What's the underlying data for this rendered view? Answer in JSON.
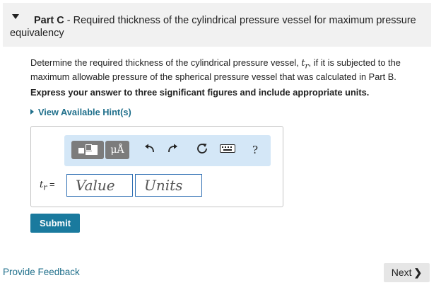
{
  "part": {
    "label": "Part C",
    "separator": " - ",
    "title": "Required thickness of the cylindrical pressure vessel for maximum pressure equivalency"
  },
  "question": {
    "before_symbol": "Determine the required thickness of the cylindrical pressure vessel, ",
    "symbol": "t",
    "symbol_subscript": "r",
    "after_symbol": ", if it is subjected to the maximum allowable pressure of the spherical pressure vessel that was calculated in Part B."
  },
  "instruction": "Express your answer to three significant figures and include appropriate units.",
  "hint_link": "View Available Hint(s)",
  "toolbar": {
    "units_label": "μÅ",
    "help_label": "?"
  },
  "answer": {
    "variable": "t",
    "variable_subscript": "r",
    "equals": "=",
    "value_placeholder": "Value",
    "units_placeholder": "Units"
  },
  "submit_label": "Submit",
  "feedback_link": "Provide Feedback",
  "next_label": "Next",
  "next_chevron": "❯",
  "colors": {
    "link": "#1f6f8b",
    "submit": "#1a7a9e",
    "toolbar_bg": "#d4e7f7",
    "field_border": "#2f6fb3"
  }
}
